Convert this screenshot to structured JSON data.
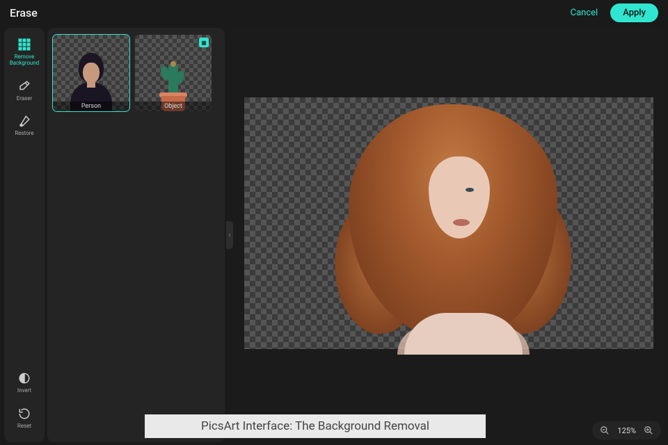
{
  "header": {
    "title": "Erase",
    "cancel": "Cancel",
    "apply": "Apply"
  },
  "rail": {
    "removeBg": "Remove\nBackground",
    "eraser": "Eraser",
    "restore": "Restore",
    "invert": "Invert",
    "reset": "Reset"
  },
  "options": {
    "person": "Person",
    "object": "Object",
    "badge_icon": "▦"
  },
  "canvas": {
    "collapse_glyph": "‹"
  },
  "caption": "PicsArt Interface: The Background Removal",
  "zoom": {
    "value": "125%"
  },
  "colors": {
    "accent": "#30e6d0"
  }
}
